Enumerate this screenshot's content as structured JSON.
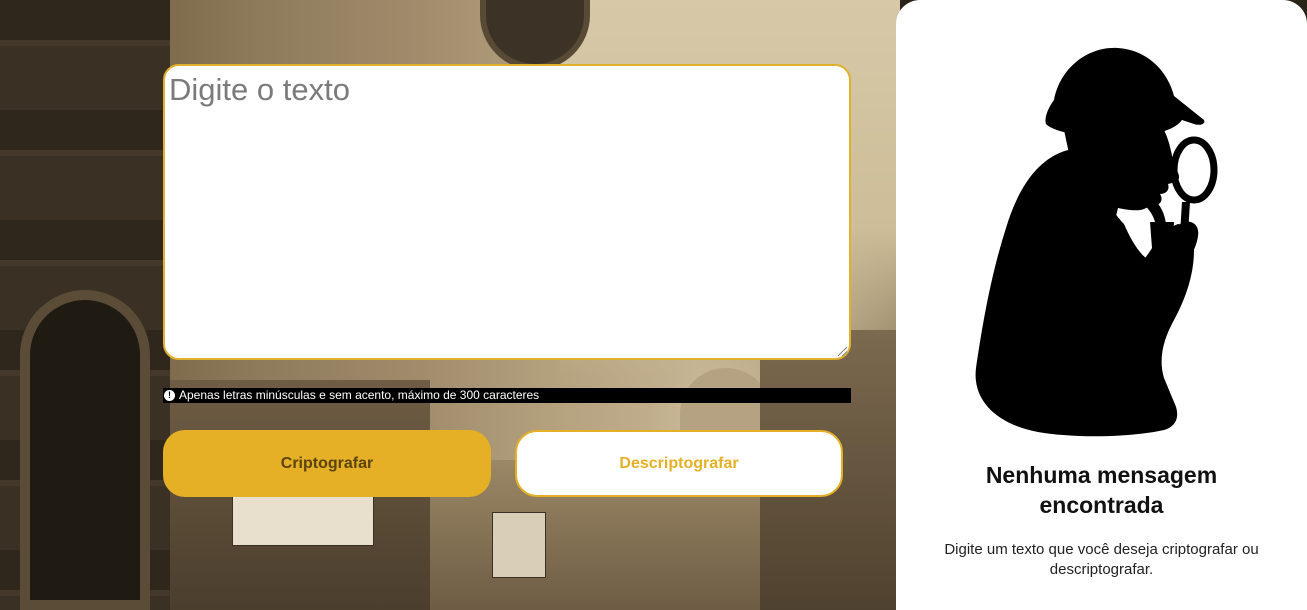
{
  "editor": {
    "placeholder": "Digite o texto",
    "value": ""
  },
  "hint": {
    "icon": "info-icon",
    "text": "Apenas letras minúsculas e sem acento, máximo de 300 caracteres"
  },
  "actions": {
    "encrypt_label": "Criptografar",
    "decrypt_label": "Descriptografar"
  },
  "output_panel": {
    "illustration": "detective-silhouette-icon",
    "title": "Nenhuma mensagem encontrada",
    "description": "Digite um texto que você deseja criptografar ou descriptografar."
  },
  "colors": {
    "accent": "#e5b025",
    "panel_background": "#ffffff",
    "hint_background": "#000000"
  }
}
